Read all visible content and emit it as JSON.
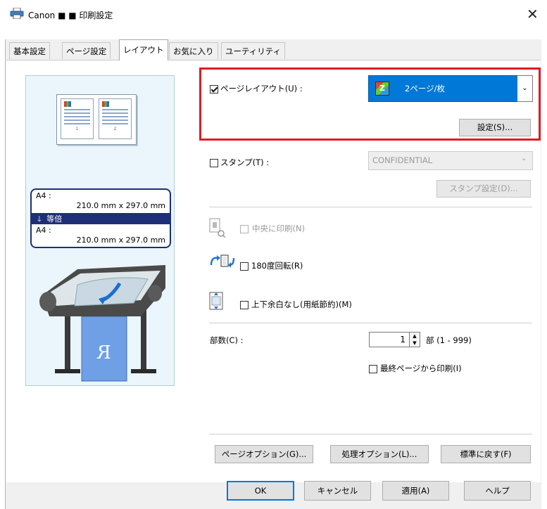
{
  "window": {
    "title": "Canon ■ ■ 印刷設定",
    "close_icon": "✕"
  },
  "tabs": [
    {
      "label": "基本設定"
    },
    {
      "label": "ページ設定"
    },
    {
      "label": "レイアウト"
    },
    {
      "label": "お気に入り"
    },
    {
      "label": "ユーティリティ"
    }
  ],
  "preview": {
    "paper_in_label": "A4 :",
    "paper_in_size": "210.0 mm x 297.0 mm",
    "scale_label": "等倍",
    "paper_out_label": "A4 :",
    "paper_out_size": "210.0 mm x 297.0 mm",
    "page_numbers": [
      "1",
      "2"
    ]
  },
  "page_layout": {
    "checkbox_label": "ページレイアウト(U) :",
    "checked": true,
    "select_value": "2ページ/枚",
    "select_icon_text": "Z",
    "settings_button": "設定(S)..."
  },
  "stamp": {
    "checkbox_label": "スタンプ(T) :",
    "checked": false,
    "select_value": "CONFIDENTIAL",
    "settings_button": "スタンプ設定(D)..."
  },
  "center_print": {
    "label": "中央に印刷(N)",
    "checked": false
  },
  "rotate_180": {
    "label": "180度回転(R)",
    "checked": false
  },
  "no_margin": {
    "label": "上下余白なし(用紙節約)(M)",
    "checked": false
  },
  "copies": {
    "label": "部数(C) :",
    "value": "1",
    "unit": "部 (1 - 999)",
    "last_page_label": "最終ページから印刷(I)",
    "last_page_checked": false
  },
  "bottom_buttons": {
    "page_options": "ページオプション(G)...",
    "processing_options": "処理オプション(L)...",
    "defaults": "標準に戻す(F)"
  },
  "dialog_buttons": {
    "ok": "OK",
    "cancel": "キャンセル",
    "apply": "適用(A)",
    "help": "ヘルプ"
  },
  "colors": {
    "accent": "#0078d7",
    "highlight_box": "#e01b24",
    "preview_bg": "#eaf6fb",
    "scale_bar": "#1e2f78"
  }
}
